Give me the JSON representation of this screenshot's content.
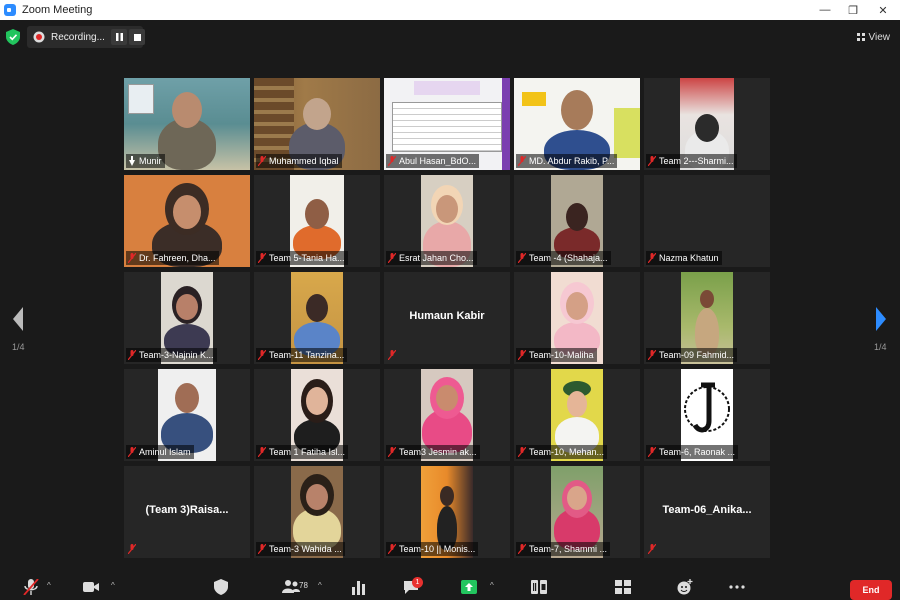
{
  "window": {
    "title": "Zoom Meeting",
    "minimize": "—",
    "restore": "❐",
    "close": "✕"
  },
  "recording": {
    "label": "Recording..."
  },
  "view": {
    "label": "View"
  },
  "pagination": {
    "left": "1/4",
    "right": "1/4"
  },
  "participants": [
    "Munir",
    "Muhammed Iqbal",
    "Abul Hasan_BdO...",
    "MD. Abdur Rakib, P...",
    "Team 2---Sharmi...",
    "Dr. Fahreen, Dha...",
    "Team 5-Tania Ha...",
    "Esrat Jahan Cho...",
    "Team -4 (Shahaja...",
    "Nazma Khatun",
    "Team-3-Najnin K...",
    "Team-11 Tanzina...",
    "Humaun Kabir",
    "Team-10-Maliha",
    "Team-09 Fahmid...",
    "Aminul Islam",
    "Team 1 Fatiha Isl...",
    "Team3 Jesmin ak...",
    "Team-10, Mehan...",
    "Team-6, Raonak ...",
    "(Team 3)Raisa...",
    "Team-3 Wahida ...",
    "Team-10 || Monis...",
    "Team-7, Shammi ...",
    "Team-06_Anika..."
  ],
  "toolbar": {
    "participants_count": "78",
    "chat_badge": "1",
    "end_label": "End"
  },
  "colors": {
    "accent": "#2d8cff",
    "active_border": "#c8e04a",
    "danger": "#e02828",
    "share": "#22c55e"
  }
}
